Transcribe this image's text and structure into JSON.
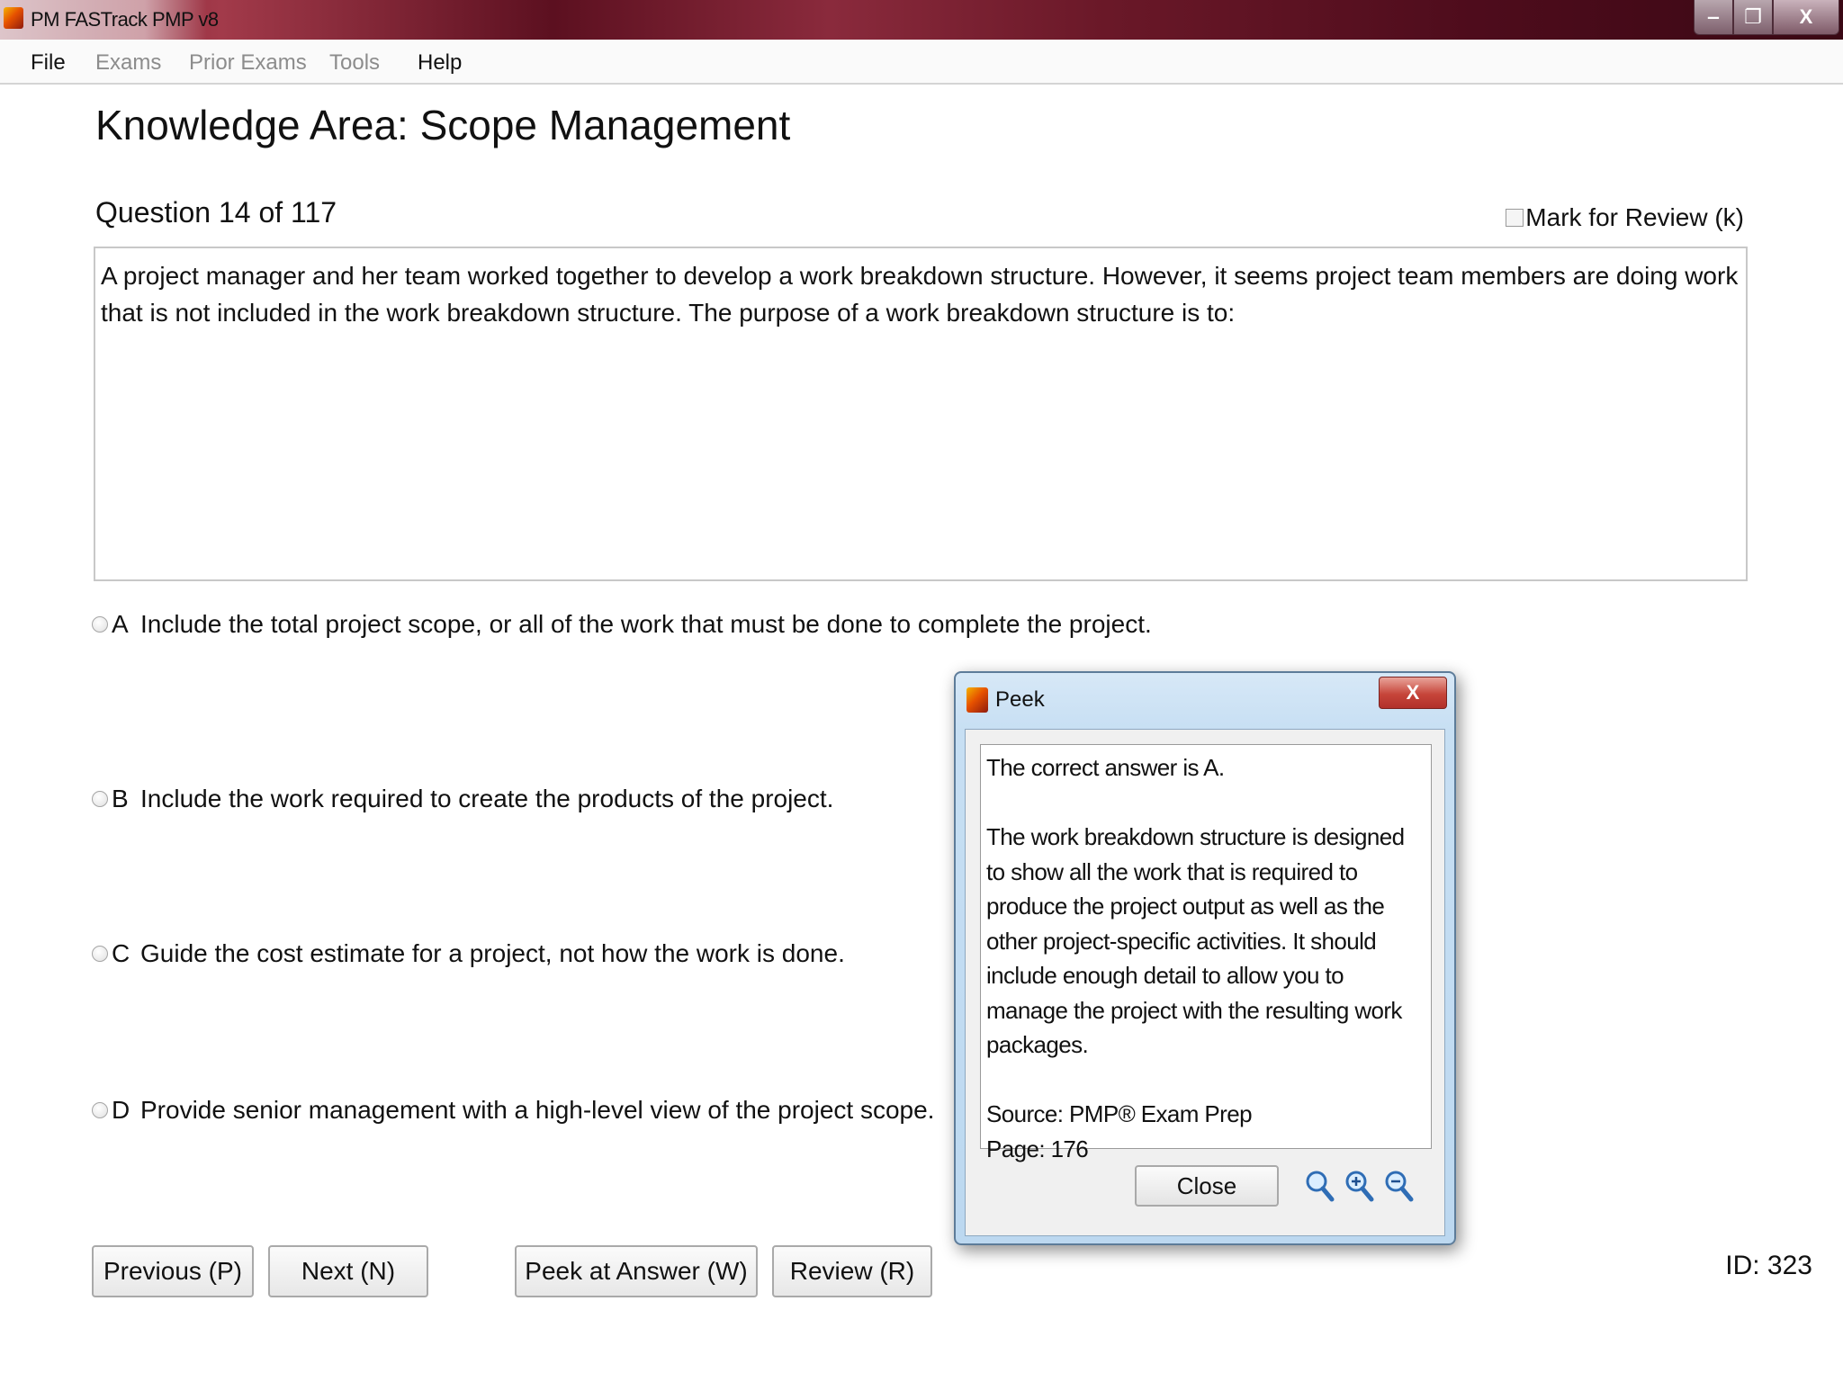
{
  "window": {
    "title": "PM FASTrack PMP v8",
    "controls": {
      "minimize": "‒",
      "restore": "❐",
      "close": "X"
    }
  },
  "menu": {
    "items": [
      {
        "label": "File",
        "enabled": true
      },
      {
        "label": "Exams",
        "enabled": false
      },
      {
        "label": "Prior Exams",
        "enabled": false
      },
      {
        "label": "Tools",
        "enabled": false
      },
      {
        "label": "Help",
        "enabled": true
      }
    ]
  },
  "exam": {
    "knowledge_area": "Knowledge Area: Scope Management",
    "question_counter": "Question 14 of 117",
    "mark_review_label": "Mark for Review (k)",
    "mark_review_checked": false,
    "question_text": "A project manager and her team worked together to develop a work breakdown structure. However, it seems project team members are doing work that is not included in the work breakdown structure. The purpose of a work breakdown structure is to:",
    "options": [
      {
        "letter": "A",
        "text": "Include the total project scope, or all of the work that must be done to complete the project."
      },
      {
        "letter": "B",
        "text": "Include the work required to create the products of the project."
      },
      {
        "letter": "C",
        "text": "Guide the cost estimate for a project, not how the work is done."
      },
      {
        "letter": "D",
        "text": "Provide senior management with a high-level view of the project scope."
      }
    ],
    "id_label": "ID: 323"
  },
  "buttons": {
    "previous": "Previous (P)",
    "next": "Next (N)",
    "peek": "Peek at Answer (W)",
    "review": "Review (R)"
  },
  "peek_dialog": {
    "title": "Peek",
    "close_x": "X",
    "answer_line": "The correct answer is A.",
    "explanation": "The work breakdown structure is designed to show all the work that is required to produce the project output as well as the other project-specific activities. It should include enough detail to allow you to manage the project with the resulting work packages.",
    "source": "Source: PMP® Exam Prep",
    "page": "Page: 176",
    "close_button": "Close",
    "icons": [
      "search-icon",
      "zoom-in-icon",
      "zoom-out-icon"
    ]
  }
}
